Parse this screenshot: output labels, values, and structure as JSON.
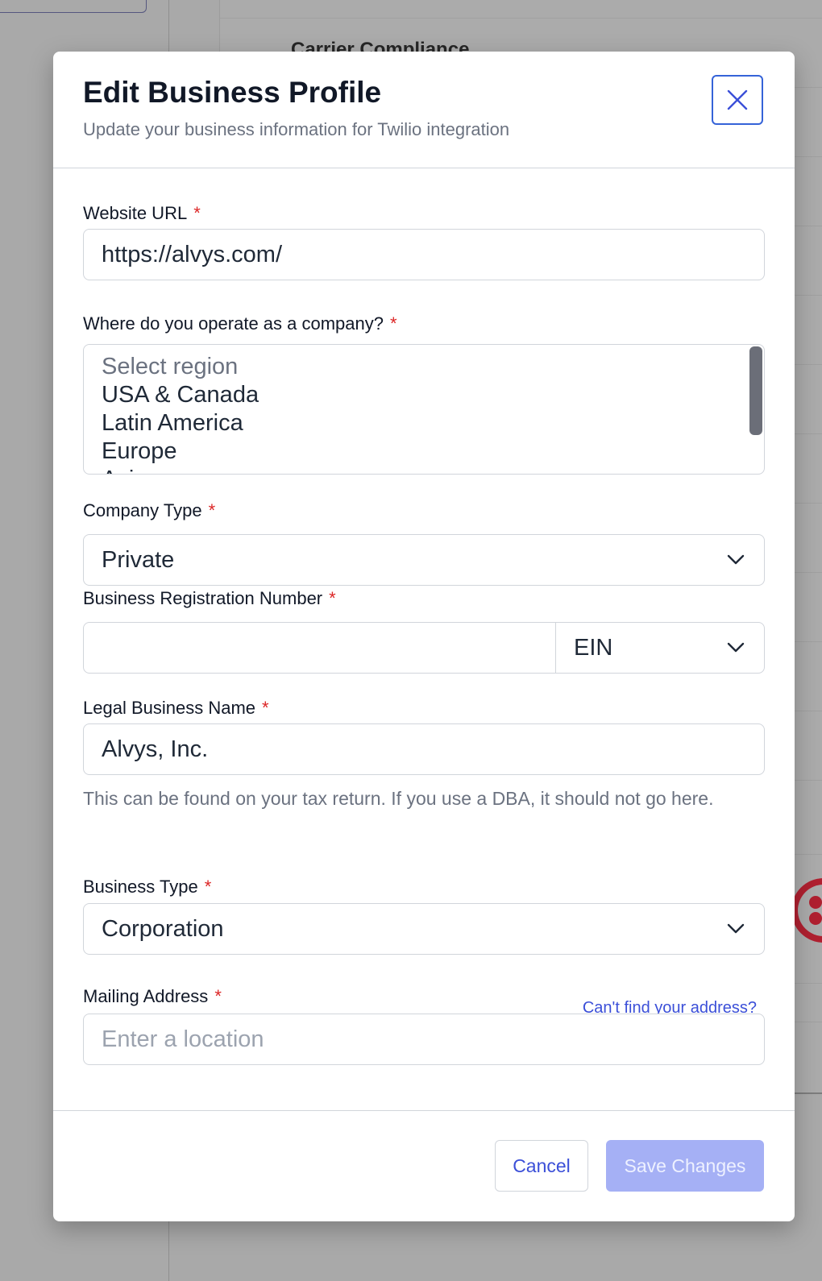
{
  "background": {
    "heading": "Carrier Compliance"
  },
  "modal": {
    "title": "Edit Business Profile",
    "subtitle": "Update your business information for Twilio integration",
    "close_icon": "close-icon"
  },
  "fields": {
    "website_url": {
      "label": "Website URL",
      "required_mark": "*",
      "value": "https://alvys.com/"
    },
    "region": {
      "label": "Where do you operate as a company?",
      "required_mark": "*",
      "options": [
        "Select region",
        "USA & Canada",
        "Latin America",
        "Europe",
        "Asia"
      ]
    },
    "company_type": {
      "label": "Company Type",
      "required_mark": "*",
      "value": "Private"
    },
    "registration_number": {
      "label": "Business Registration Number",
      "required_mark": "*",
      "value": "",
      "id_type": "EIN"
    },
    "legal_name": {
      "label": "Legal Business Name",
      "required_mark": "*",
      "value": "Alvys, Inc.",
      "helper": "This can be found on your tax return. If you use a DBA, it should not go here."
    },
    "business_type": {
      "label": "Business Type",
      "required_mark": "*",
      "value": "Corporation"
    },
    "mailing_address": {
      "label": "Mailing Address",
      "required_mark": "*",
      "placeholder": "Enter a location",
      "link": "Can't find your address?"
    }
  },
  "footer": {
    "cancel_label": "Cancel",
    "save_label": "Save Changes"
  },
  "colors": {
    "accent": "#3b4fd8",
    "required": "#dc2626",
    "save_disabled": "#a5b0f5"
  }
}
